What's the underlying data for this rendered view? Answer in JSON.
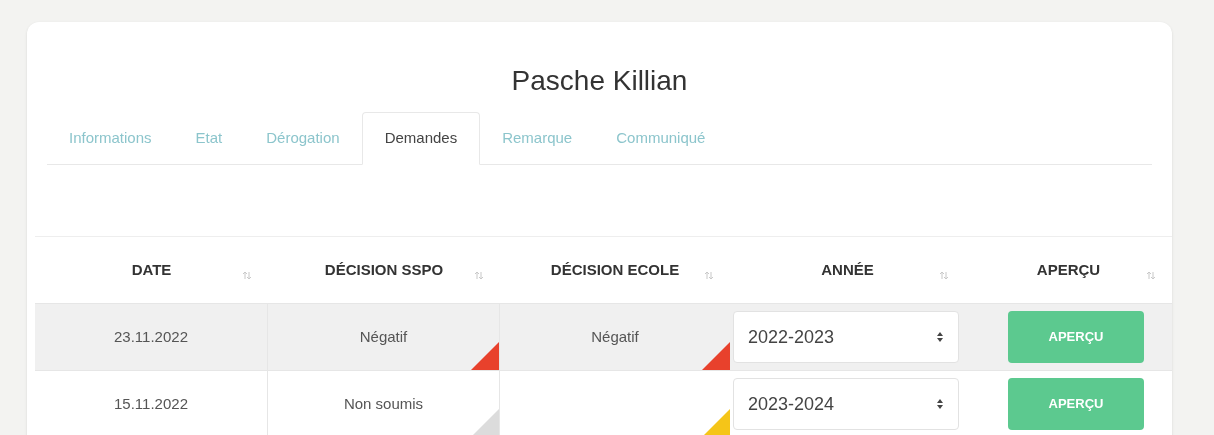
{
  "title": "Pasche Killian",
  "tabs": [
    {
      "label": "Informations",
      "selected": false
    },
    {
      "label": "Etat",
      "selected": false
    },
    {
      "label": "Dérogation",
      "selected": false
    },
    {
      "label": "Demandes",
      "selected": true
    },
    {
      "label": "Remarque",
      "selected": false
    },
    {
      "label": "Communiqué",
      "selected": false
    }
  ],
  "table": {
    "columns": [
      "DATE",
      "DÉCISION SSPO",
      "DÉCISION ECOLE",
      "ANNÉE",
      "APERÇU"
    ],
    "rows": [
      {
        "shaded": true,
        "date": "23.11.2022",
        "decision_sspo": {
          "text": "Négatif",
          "color": "#e8412c"
        },
        "decision_ecole": {
          "text": "Négatif",
          "color": "#e8412c"
        },
        "annee": "2022-2023",
        "apercu": "APERÇU"
      },
      {
        "shaded": false,
        "date": "15.11.2022",
        "decision_sspo": {
          "text": "Non soumis",
          "color": "#dcdcdc"
        },
        "decision_ecole": {
          "color": "#f5c518"
        },
        "annee": "2023-2024",
        "apercu": "APERÇU"
      }
    ]
  }
}
